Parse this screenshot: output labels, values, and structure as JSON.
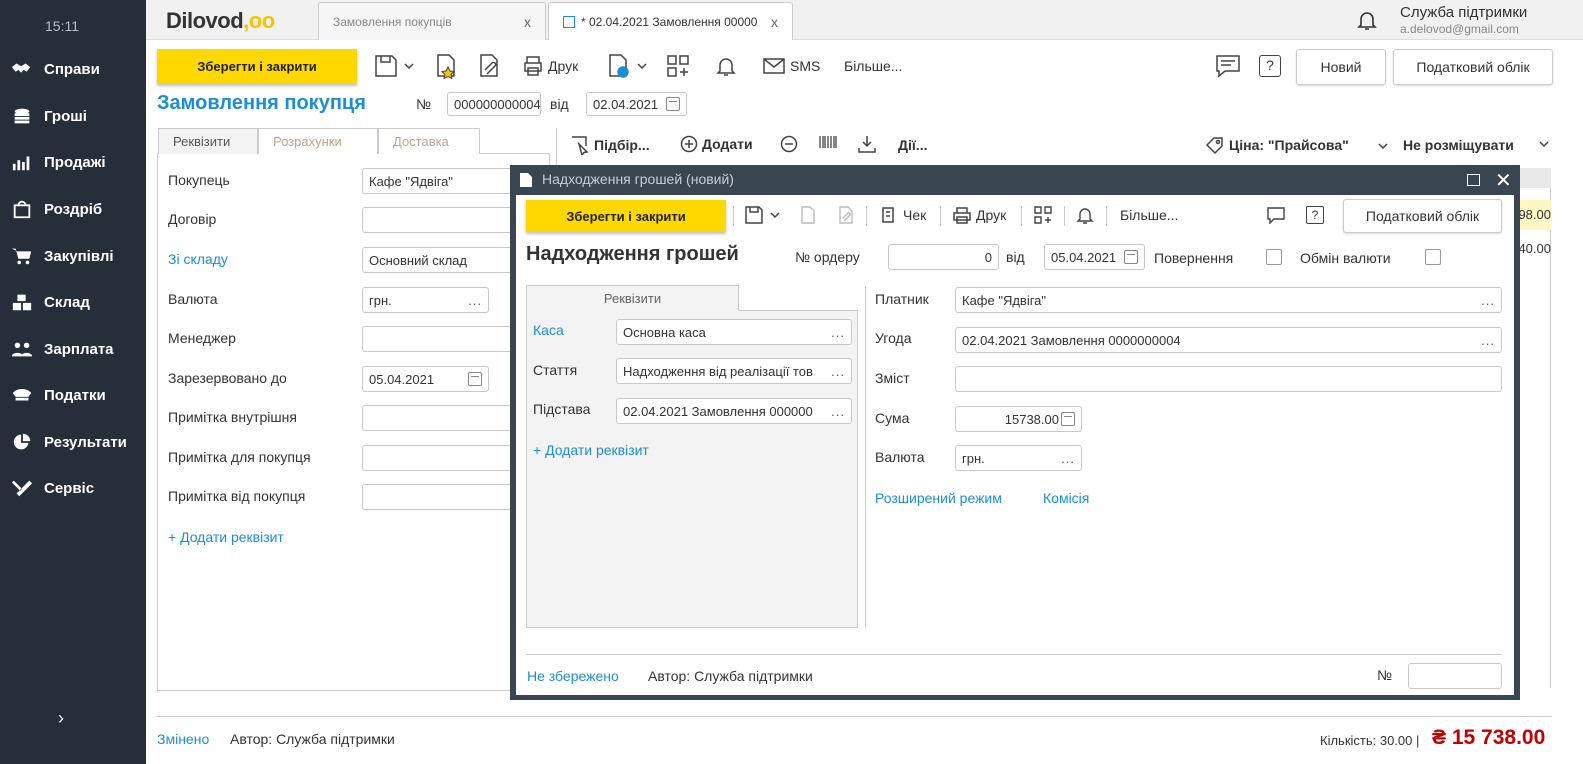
{
  "sidebar": {
    "time": "15:11",
    "items": [
      {
        "label": "Справи",
        "icon": "handshake-icon"
      },
      {
        "label": "Гроші",
        "icon": "coins-icon"
      },
      {
        "label": "Продажі",
        "icon": "chart-icon"
      },
      {
        "label": "Роздріб",
        "icon": "shopping-bag-icon"
      },
      {
        "label": "Закупівлі",
        "icon": "cart-icon"
      },
      {
        "label": "Склад",
        "icon": "boxes-icon"
      },
      {
        "label": "Зарплата",
        "icon": "people-icon"
      },
      {
        "label": "Податки",
        "icon": "officer-cap-icon"
      },
      {
        "label": "Результати",
        "icon": "pie-chart-icon"
      },
      {
        "label": "Сервіс",
        "icon": "tools-icon"
      }
    ],
    "collapse": "›"
  },
  "header": {
    "logo_text": "Dilovod",
    "logo_dots": ",oo",
    "tabs": [
      {
        "label": "Замовлення покупців",
        "close": "x"
      },
      {
        "label": "* 02.04.2021 Замовлення 00000",
        "close": "x"
      }
    ],
    "support_name": "Служба підтримки",
    "support_email": "a.delovod@gmail.com"
  },
  "toolbar": {
    "save_close": "Зберегти і закрити",
    "print": "Друк",
    "sms": "SMS",
    "more": "Більше...",
    "help": "?",
    "new": "Новий",
    "tax": "Податковий облік"
  },
  "order": {
    "title": "Замовлення покупця",
    "no_label": "№",
    "number": "000000000004",
    "from_label": "від",
    "date": "02.04.2021",
    "form_tabs": [
      "Реквізити",
      "Розрахунки",
      "Доставка"
    ],
    "fields": [
      {
        "label": "Покупець",
        "value": "Кафе \"Ядвіга\"",
        "link": false
      },
      {
        "label": "Договір",
        "value": "",
        "link": false
      },
      {
        "label": "Зі складу",
        "value": "Основний склад",
        "link": true
      },
      {
        "label": "Валюта",
        "value": "грн.",
        "link": false
      },
      {
        "label": "Менеджер",
        "value": "",
        "link": false
      },
      {
        "label": "Зарезервовано до",
        "value": "05.04.2021",
        "link": false
      },
      {
        "label": "Примітка внутрішня",
        "value": "",
        "link": false
      },
      {
        "label": "Примітка для покупця",
        "value": "",
        "link": false
      },
      {
        "label": "Примітка від покупця",
        "value": "",
        "link": false
      }
    ],
    "add_requisite": "+ Додати реквізит",
    "goods_toolbar": {
      "pick": "Підбір...",
      "add": "Додати",
      "actions": "Дії...",
      "price": "Ціна: \"Прайсова\"",
      "placement": "Не розміщувати"
    },
    "row_values": [
      "98.00",
      "40.00"
    ],
    "status": "Змінено",
    "author": "Автор: Служба підтримки",
    "quantity": "Кількість: 30.00 |",
    "total": "₴ 15 738.00"
  },
  "modal": {
    "window_title": "Надходження грошей (новий)",
    "save_close": "Зберегти і закрити",
    "check": "Чек",
    "print": "Друк",
    "more": "Більше...",
    "help": "?",
    "tax": "Податковий облік",
    "heading": "Надходження грошей",
    "order_no_label": "№ ордеру",
    "order_no": "0",
    "from_label": "від",
    "date": "05.04.2021",
    "return_label": "Повернення",
    "exchange_label": "Обмін валюти",
    "tab": "Реквізити",
    "left_fields": [
      {
        "label": "Каса",
        "value": "Основна каса",
        "link": true
      },
      {
        "label": "Стаття",
        "value": "Надходження від реалізації тов",
        "link": false
      },
      {
        "label": "Підстава",
        "value": "02.04.2021 Замовлення 000000",
        "link": false
      }
    ],
    "add_requisite": "+ Додати реквізит",
    "payer_label": "Платник",
    "payer": "Кафе \"Ядвіга\"",
    "deal_label": "Угода",
    "deal": "02.04.2021 Замовлення 0000000004",
    "content_label": "Зміст",
    "content": "",
    "sum_label": "Сума",
    "sum": "15738.00",
    "currency_label": "Валюта",
    "currency": "грн.",
    "extended": "Розширений режим",
    "commission": "Комісія",
    "status": "Не збережено",
    "author": "Автор: Служба підтримки",
    "no_label": "№"
  },
  "colors": {
    "sidebar": "#262e39",
    "accent": "#ffd800",
    "link": "#1c8fd1",
    "total": "#c00000"
  }
}
